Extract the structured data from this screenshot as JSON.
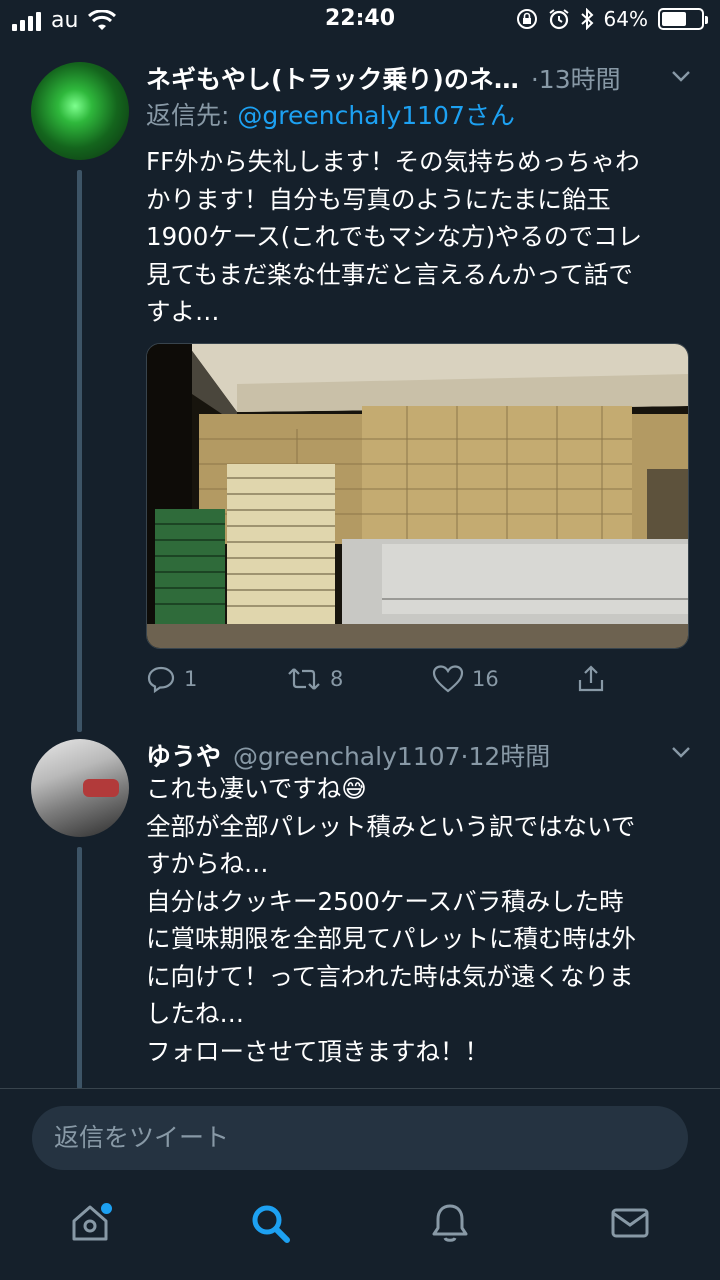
{
  "status_bar": {
    "carrier": "au",
    "time": "22:40",
    "battery": "64%",
    "battery_level": 0.64
  },
  "tweets": [
    {
      "display_name": "ネギもやし(トラック乗り)のネ…",
      "time": "·13時間",
      "reply_prefix": "返信先: ",
      "reply_mention": "@greenchaly1107さん",
      "text": "FF外から失礼します！その気持ちめっちゃわ\nかります！自分も写真のようにたまに飴玉\n1900ケース(これでもマシな方)やるのでコレ\n見てもまだ楽な仕事だと言えるんかって話で\nすよ…",
      "actions": {
        "reply_count": "1",
        "retweet_count": "8",
        "like_count": "16"
      }
    },
    {
      "display_name": "ゆうや",
      "handle": "@greenchaly1107",
      "time": "·12時間",
      "text": "これも凄いですね😅\n全部が全部パレット積みという訳ではないで\nすからね…\n自分はクッキー2500ケースバラ積みした時\nに賞味期限を全部見てパレットに積む時は外\nに向けて！って言われた時は気が遠くなりま\nしたね…\nフォローさせて頂きますね！！"
    }
  ],
  "reply_bar": {
    "placeholder": "返信をツイート"
  },
  "tab_bar": {
    "items": [
      "home-icon",
      "search-icon",
      "notifications-icon",
      "messages-icon"
    ],
    "active": "search-icon"
  },
  "colors": {
    "background": "#15202b",
    "accent": "#1da1f2",
    "secondary_text": "#8899a6"
  }
}
